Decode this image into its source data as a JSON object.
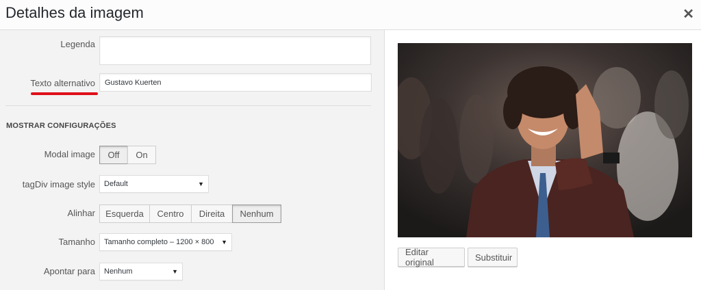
{
  "header": {
    "title": "Detalhes da imagem",
    "close_icon": "close-icon"
  },
  "fields": {
    "caption_label": "Legenda",
    "caption_value": "",
    "alt_label": "Texto alternativo",
    "alt_value": "Gustavo Kuerten"
  },
  "settings": {
    "heading": "Mostrar configurações",
    "modal_image": {
      "label": "Modal image",
      "options": [
        "Off",
        "On"
      ],
      "selected": "Off"
    },
    "tagdiv_style": {
      "label": "tagDiv image style",
      "value": "Default"
    },
    "align": {
      "label": "Alinhar",
      "options": [
        "Esquerda",
        "Centro",
        "Direita",
        "Nenhum"
      ],
      "selected": "Nenhum"
    },
    "size": {
      "label": "Tamanho",
      "value": "Tamanho completo – 1200 × 800"
    },
    "link_to": {
      "label": "Apontar para",
      "value": "Nenhum"
    }
  },
  "preview": {
    "edit_label": "Editar original",
    "replace_label": "Substituir"
  },
  "colors": {
    "highlight_underline": "#e0101c",
    "active_button_border": "#999999"
  }
}
